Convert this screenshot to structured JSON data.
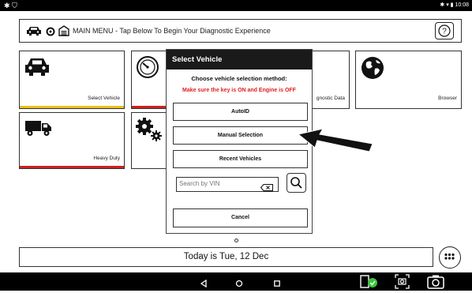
{
  "statusbar": {
    "left_icons": [
      "bug-icon",
      "shield-icon"
    ],
    "time": "10:08"
  },
  "header": {
    "title": "MAIN MENU - Tap Below To Begin Your Diagnostic Experience",
    "help_label": "?"
  },
  "tiles": [
    {
      "label": "Select Vehicle",
      "icon": "car-icon",
      "bar_color": "#e6c21e"
    },
    {
      "label": "",
      "icon": "gauge-icon",
      "bar_color": "#cc2222"
    },
    {
      "label": "gnostic Data",
      "icon": "",
      "bar_color": ""
    },
    {
      "label": "Browser",
      "icon": "globe-icon",
      "bar_color": ""
    },
    {
      "label": "Heavy Duty",
      "icon": "truck-icon",
      "bar_color": "#cc2222"
    },
    {
      "label": "",
      "icon": "gears-icon",
      "bar_color": ""
    }
  ],
  "modal": {
    "title": "Select Vehicle",
    "prompt": "Choose vehicle selection method:",
    "warning": "Make sure the key is ON and Engine is OFF",
    "buttons": {
      "autoid": "AutoID",
      "manual": "Manual Selection",
      "recent": "Recent Vehicles",
      "cancel": "Cancel"
    },
    "vin_placeholder": "Search by VIN"
  },
  "date_text": "Today is Tue, 12 Dec",
  "colors": {
    "warning": "#e02020",
    "yellow_bar": "#e6c21e",
    "red_bar": "#cc2222",
    "status_green": "#3ec23e"
  }
}
